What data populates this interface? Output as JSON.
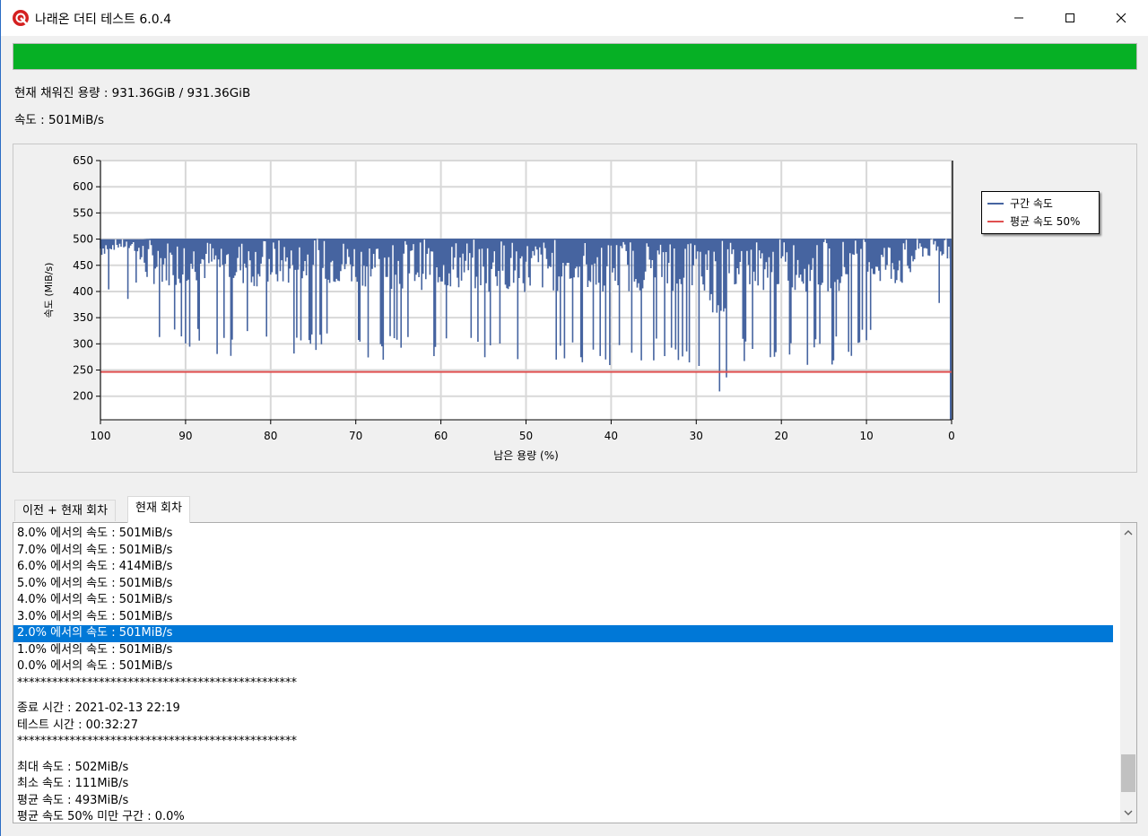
{
  "window": {
    "title": "나래온 더티 테스트 6.0.4"
  },
  "progress": {
    "fraction": 1.0,
    "color": "#06b025"
  },
  "status": {
    "filled": "현재 채워진 용량 : 931.36GiB / 931.36GiB",
    "speed": "속도 : 501MiB/s"
  },
  "chart_data": {
    "type": "area",
    "xlabel": "남은 용량 (%)",
    "ylabel": "속도 (MiB/s)",
    "xlim": [
      100,
      0
    ],
    "ylim": [
      155,
      650
    ],
    "x_ticks": [
      100,
      90,
      80,
      70,
      60,
      50,
      40,
      30,
      20,
      10,
      0
    ],
    "y_ticks": [
      200,
      250,
      300,
      350,
      400,
      450,
      500,
      550,
      600,
      650
    ],
    "grid": true,
    "legend_position": "right",
    "series": [
      {
        "name": "구간 속도",
        "color": "#4664a0",
        "x": [
          100,
          99,
          98,
          97,
          96,
          95.5,
          95,
          94,
          92,
          90,
          88,
          85,
          80,
          75,
          70,
          65,
          60,
          55,
          50,
          45,
          40,
          35,
          30,
          27,
          25,
          20,
          15,
          10,
          7,
          5,
          4,
          2,
          0
        ],
        "min": [
          445,
          462,
          470,
          468,
          462,
          430,
          378,
          365,
          360,
          365,
          370,
          360,
          355,
          365,
          360,
          350,
          350,
          345,
          340,
          345,
          340,
          350,
          340,
          250,
          345,
          350,
          340,
          360,
          360,
          350,
          440,
          445,
          440
        ],
        "max": [
          500,
          500,
          500,
          500,
          500,
          500,
          500,
          501,
          501,
          501,
          501,
          501,
          501,
          501,
          501,
          501,
          501,
          501,
          501,
          501,
          501,
          501,
          501,
          501,
          501,
          501,
          501,
          501,
          501,
          501,
          501,
          501,
          501
        ]
      },
      {
        "name": "평균 속도 50%",
        "color": "#e05050",
        "value": 246.5
      }
    ]
  },
  "tabs": [
    {
      "label": "이전 + 현재 회차",
      "active": false
    },
    {
      "label": "현재 회차",
      "active": true
    }
  ],
  "log": {
    "lines": [
      "8.0% 에서의 속도 : 501MiB/s",
      "7.0% 에서의 속도 : 501MiB/s",
      "6.0% 에서의 속도 : 414MiB/s",
      "5.0% 에서의 속도 : 501MiB/s",
      "4.0% 에서의 속도 : 501MiB/s",
      "3.0% 에서의 속도 : 501MiB/s",
      "2.0% 에서의 속도 : 501MiB/s",
      "1.0% 에서의 속도 : 501MiB/s",
      "0.0% 에서의 속도 : 501MiB/s",
      "************************************************",
      "",
      "종료 시간 : 2021-02-13 22:19",
      "테스트 시간 : 00:32:27",
      "************************************************",
      "",
      "최대 속도 : 502MiB/s",
      "최소 속도 : 111MiB/s",
      "평균 속도 : 493MiB/s",
      "평균 속도 50% 미만 구간 : 0.0%",
      "************************************************"
    ],
    "selected_index": 6,
    "scroll_fraction": 0.95
  }
}
